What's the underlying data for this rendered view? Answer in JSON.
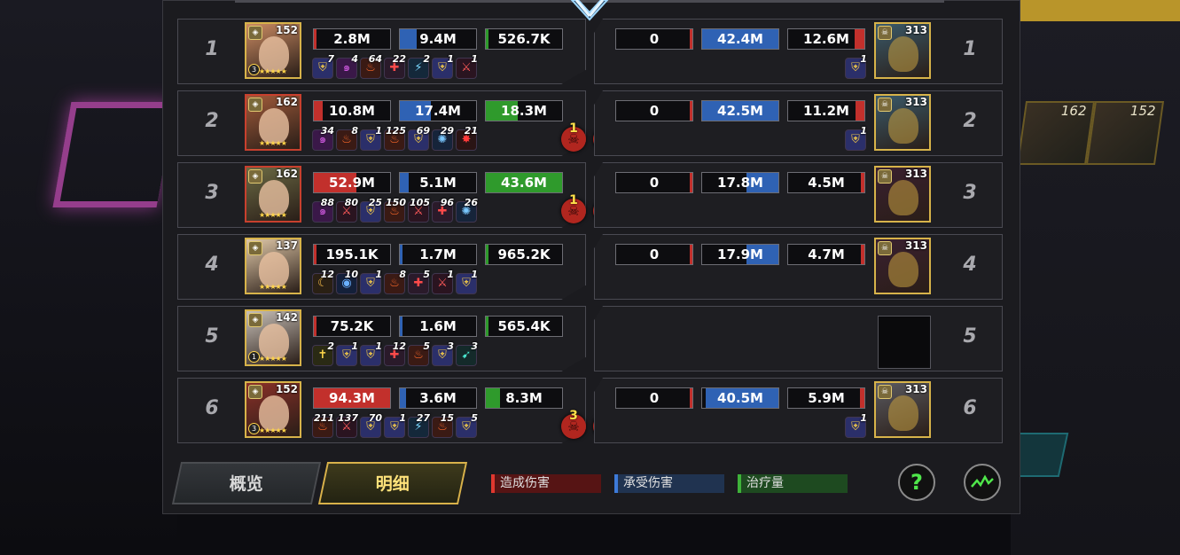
{
  "left_rows": [
    {
      "rank": "1",
      "level": "152",
      "border": "gold",
      "grade": "3",
      "dealt": "2.8M",
      "dealt_fill": 0.03,
      "taken": "9.4M",
      "taken_fill": 0.22,
      "heal": "526.7K",
      "heal_fill": 0.01,
      "buffs": [
        {
          "icon": "shield-icon",
          "n": "7"
        },
        {
          "icon": "vortex-icon",
          "n": "4"
        },
        {
          "icon": "fire-icon",
          "n": "64"
        },
        {
          "icon": "cross-icon",
          "n": "22"
        },
        {
          "icon": "bolt-icon",
          "n": "2"
        },
        {
          "icon": "shield-icon",
          "n": "1"
        },
        {
          "icon": "blade-icon",
          "n": "1"
        }
      ],
      "kills": []
    },
    {
      "rank": "2",
      "level": "162",
      "border": "red",
      "grade": "",
      "dealt": "10.8M",
      "dealt_fill": 0.12,
      "taken": "17.4M",
      "taken_fill": 0.41,
      "heal": "18.3M",
      "heal_fill": 0.42,
      "buffs": [
        {
          "icon": "vortex-icon",
          "n": "34"
        },
        {
          "icon": "fire-icon",
          "n": "8"
        },
        {
          "icon": "shield-icon",
          "n": "1"
        },
        {
          "icon": "fire-icon",
          "n": "125"
        },
        {
          "icon": "shield-icon",
          "n": "69"
        },
        {
          "icon": "orb-icon",
          "n": "29"
        },
        {
          "icon": "burst-icon",
          "n": "21"
        }
      ],
      "kills": [
        "1",
        "1"
      ]
    },
    {
      "rank": "3",
      "level": "162",
      "border": "red",
      "grade": "",
      "dealt": "52.9M",
      "dealt_fill": 0.56,
      "taken": "5.1M",
      "taken_fill": 0.12,
      "heal": "43.6M",
      "heal_fill": 1.0,
      "buffs": [
        {
          "icon": "vortex-icon",
          "n": "88"
        },
        {
          "icon": "blade-icon",
          "n": "80"
        },
        {
          "icon": "shield-icon",
          "n": "25"
        },
        {
          "icon": "fire-icon",
          "n": "150"
        },
        {
          "icon": "blade-icon",
          "n": "105"
        },
        {
          "icon": "cross-icon",
          "n": "96"
        },
        {
          "icon": "orb-icon",
          "n": "26"
        }
      ],
      "kills": [
        "1",
        "1"
      ]
    },
    {
      "rank": "4",
      "level": "137",
      "border": "gold",
      "grade": "",
      "dealt": "195.1K",
      "dealt_fill": 0.0,
      "taken": "1.7M",
      "taken_fill": 0.04,
      "heal": "965.2K",
      "heal_fill": 0.02,
      "buffs": [
        {
          "icon": "moon-icon",
          "n": "12"
        },
        {
          "icon": "eye-icon",
          "n": "10"
        },
        {
          "icon": "shield-icon",
          "n": "1"
        },
        {
          "icon": "fire-icon",
          "n": "8"
        },
        {
          "icon": "cross-icon",
          "n": "5"
        },
        {
          "icon": "blade-icon",
          "n": "1"
        },
        {
          "icon": "shield-icon",
          "n": "1"
        }
      ],
      "kills": []
    },
    {
      "rank": "5",
      "level": "142",
      "border": "gold",
      "grade": "1",
      "dealt": "75.2K",
      "dealt_fill": 0.0,
      "taken": "1.6M",
      "taken_fill": 0.04,
      "heal": "565.4K",
      "heal_fill": 0.01,
      "buffs": [
        {
          "icon": "sword-icon",
          "n": "2"
        },
        {
          "icon": "shield-icon",
          "n": "1"
        },
        {
          "icon": "shield-icon",
          "n": "1"
        },
        {
          "icon": "cross-icon",
          "n": "12"
        },
        {
          "icon": "fire-icon",
          "n": "5"
        },
        {
          "icon": "shield-icon",
          "n": "3"
        },
        {
          "icon": "run-icon",
          "n": "3"
        }
      ],
      "kills": []
    },
    {
      "rank": "6",
      "level": "152",
      "border": "gold",
      "grade": "3",
      "dealt": "94.3M",
      "dealt_fill": 1.0,
      "taken": "3.6M",
      "taken_fill": 0.08,
      "heal": "8.3M",
      "heal_fill": 0.19,
      "buffs": [
        {
          "icon": "fire-icon",
          "n": "211"
        },
        {
          "icon": "blade-icon",
          "n": "137"
        },
        {
          "icon": "shield-icon",
          "n": "70"
        },
        {
          "icon": "shield-icon",
          "n": "1"
        },
        {
          "icon": "bolt-icon",
          "n": "27"
        },
        {
          "icon": "fire-icon",
          "n": "15"
        },
        {
          "icon": "shield-icon",
          "n": "5"
        }
      ],
      "kills": [
        "3",
        "1"
      ]
    }
  ],
  "right_rows": [
    {
      "rank": "1",
      "level": "313",
      "empty": false,
      "dealt": "0",
      "dealt_fill": 0.0,
      "taken": "42.4M",
      "taken_fill": 1.0,
      "heal": "12.6M",
      "heal_fill": 0.13,
      "buffs": [
        {
          "icon": "shield-icon",
          "n": "1"
        }
      ]
    },
    {
      "rank": "2",
      "level": "313",
      "empty": false,
      "dealt": "0",
      "dealt_fill": 0.0,
      "taken": "42.5M",
      "taken_fill": 1.0,
      "heal": "11.2M",
      "heal_fill": 0.12,
      "buffs": [
        {
          "icon": "shield-icon",
          "n": "1"
        }
      ]
    },
    {
      "rank": "3",
      "level": "313",
      "empty": false,
      "dealt": "0",
      "dealt_fill": 0.0,
      "taken": "17.8M",
      "taken_fill": 0.42,
      "heal": "4.5M",
      "heal_fill": 0.05,
      "buffs": []
    },
    {
      "rank": "4",
      "level": "313",
      "empty": false,
      "dealt": "0",
      "dealt_fill": 0.0,
      "taken": "17.9M",
      "taken_fill": 0.42,
      "heal": "4.7M",
      "heal_fill": 0.05,
      "buffs": []
    },
    {
      "rank": "5",
      "level": "",
      "empty": true,
      "dealt": "",
      "dealt_fill": 0,
      "taken": "",
      "taken_fill": 0,
      "heal": "",
      "heal_fill": 0,
      "buffs": []
    },
    {
      "rank": "6",
      "level": "313",
      "empty": false,
      "dealt": "0",
      "dealt_fill": 0.0,
      "taken": "40.5M",
      "taken_fill": 0.95,
      "heal": "5.9M",
      "heal_fill": 0.06,
      "buffs": [
        {
          "icon": "shield-icon",
          "n": "1"
        }
      ]
    }
  ],
  "tabs": {
    "overview": "概览",
    "detail": "明细"
  },
  "legend": {
    "dealt": "造成伤害",
    "taken": "承受伤害",
    "heal": "治疗量"
  },
  "help_label": "?",
  "bg_cards": [
    "162",
    "152"
  ],
  "colors": {
    "dealt": "#c2302c",
    "taken": "#2f62b4",
    "heal": "#2f9a2c",
    "gold": "#d7b34a"
  }
}
